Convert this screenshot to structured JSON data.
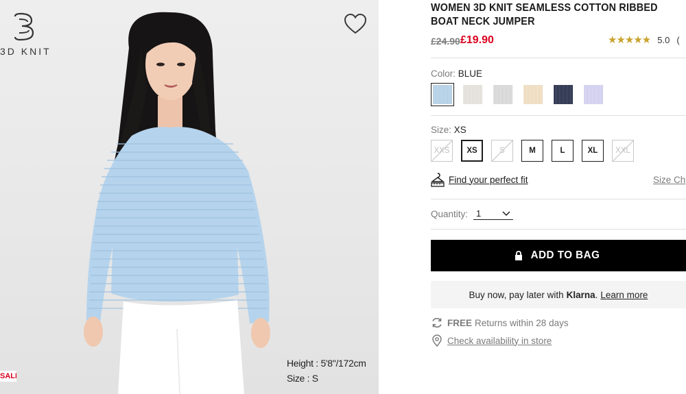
{
  "brand": {
    "logo_text": "3D KNIT",
    "logo_icon": "3d-knit-logo-icon"
  },
  "image": {
    "favorite_icon": "heart-icon",
    "caption_height": "Height : 5'8\"/172cm",
    "caption_size": "Size : S",
    "badge": "SALE"
  },
  "product": {
    "title": "WOMEN 3D KNIT SEAMLESS COTTON RIBBED BOAT NECK JUMPER",
    "price_old": "£24.90",
    "price_new": "£19.90",
    "rating_stars": "★★★★★",
    "rating_value": "5.0",
    "rating_count": "(",
    "colors": {
      "price_new": "#d9001d",
      "stars": "#c9a22c",
      "button": "#000000"
    }
  },
  "color": {
    "label": "Color:",
    "selected": "BLUE",
    "swatches": [
      {
        "name": "BLUE",
        "hex": "#b5d3ec",
        "selected": true
      },
      {
        "name": "OFF WHITE",
        "hex": "#e9e6df",
        "selected": false
      },
      {
        "name": "LIGHT GRAY",
        "hex": "#dcdcdc",
        "selected": false
      },
      {
        "name": "NATURAL",
        "hex": "#f5e2c4",
        "selected": false
      },
      {
        "name": "NAVY",
        "hex": "#1d2543",
        "selected": false
      },
      {
        "name": "PURPLE",
        "hex": "#d6d4f5",
        "selected": false
      }
    ]
  },
  "size": {
    "label": "Size:",
    "selected": "XS",
    "options": [
      {
        "label": "XXS",
        "state": "disabled"
      },
      {
        "label": "XS",
        "state": "selected"
      },
      {
        "label": "S",
        "state": "disabled"
      },
      {
        "label": "M",
        "state": "available"
      },
      {
        "label": "L",
        "state": "available"
      },
      {
        "label": "XL",
        "state": "available"
      },
      {
        "label": "XXL",
        "state": "disabled"
      }
    ],
    "fit_icon": "hanger-ruler-icon",
    "fit_link": "Find your perfect fit",
    "chart_link": "Size Ch"
  },
  "quantity": {
    "label": "Quantity:",
    "value": "1",
    "chevron_icon": "chevron-down-icon"
  },
  "cart": {
    "button_label": "ADD TO BAG",
    "icon": "lock-icon"
  },
  "klarna": {
    "text": "Buy now, pay later with",
    "brand": "Klarna",
    "period": ".",
    "learn_more": "Learn more"
  },
  "services": {
    "returns_icon": "refresh-icon",
    "returns_bold": "FREE",
    "returns_text": "Returns within 28 days",
    "store_icon": "location-pin-icon",
    "store_link": "Check availability in store"
  }
}
